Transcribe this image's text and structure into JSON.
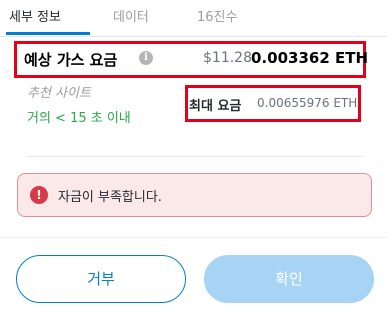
{
  "tabs": [
    {
      "label": "세부 정보",
      "active": true
    },
    {
      "label": "데이터",
      "active": false
    },
    {
      "label": "16진수",
      "active": false
    }
  ],
  "gas": {
    "label": "예상 가스 요금",
    "info_icon": "info-circle-icon",
    "usd": "$11.28",
    "eth": "0.003362 ETH",
    "site_label": "추천 사이트",
    "time_label": "거의 < 15 초 이내",
    "max_label": "최대 요금",
    "max_value": "0.00655976 ETH"
  },
  "error": {
    "icon": "exclamation-circle-icon",
    "message": "자금이 부족합니다."
  },
  "buttons": {
    "reject_label": "거부",
    "confirm_label": "확인",
    "confirm_disabled": true
  },
  "colors": {
    "accent": "#037dd6",
    "highlight_box": "#e2001a",
    "success": "#28a745",
    "error": "#d73a49",
    "error_bg": "#fbe9ea",
    "confirm_disabled_bg": "#a7d4f5"
  }
}
